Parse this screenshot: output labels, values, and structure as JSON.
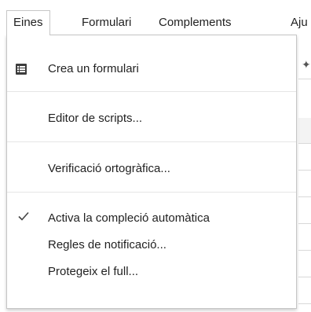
{
  "menubar": {
    "items": [
      {
        "label": "Eines"
      },
      {
        "label": "Formulari"
      },
      {
        "label": "Complements"
      },
      {
        "label": "Aju"
      }
    ]
  },
  "dropdown": {
    "items": [
      {
        "label": "Crea un formulari",
        "icon": "form-list-icon"
      },
      {
        "label": "Editor de scripts..."
      },
      {
        "label": "Verificació ortogràfica..."
      },
      {
        "label": "Activa la compleció automàtica",
        "checked": true,
        "icon": "checkmark-icon"
      },
      {
        "label": "Regles de notificació..."
      },
      {
        "label": "Protegeix el full..."
      }
    ]
  },
  "colors": {
    "menu_border": "#c6c6c6",
    "separator": "#e5e5e5",
    "text": "#222222",
    "icon": "#3c3c3c"
  }
}
